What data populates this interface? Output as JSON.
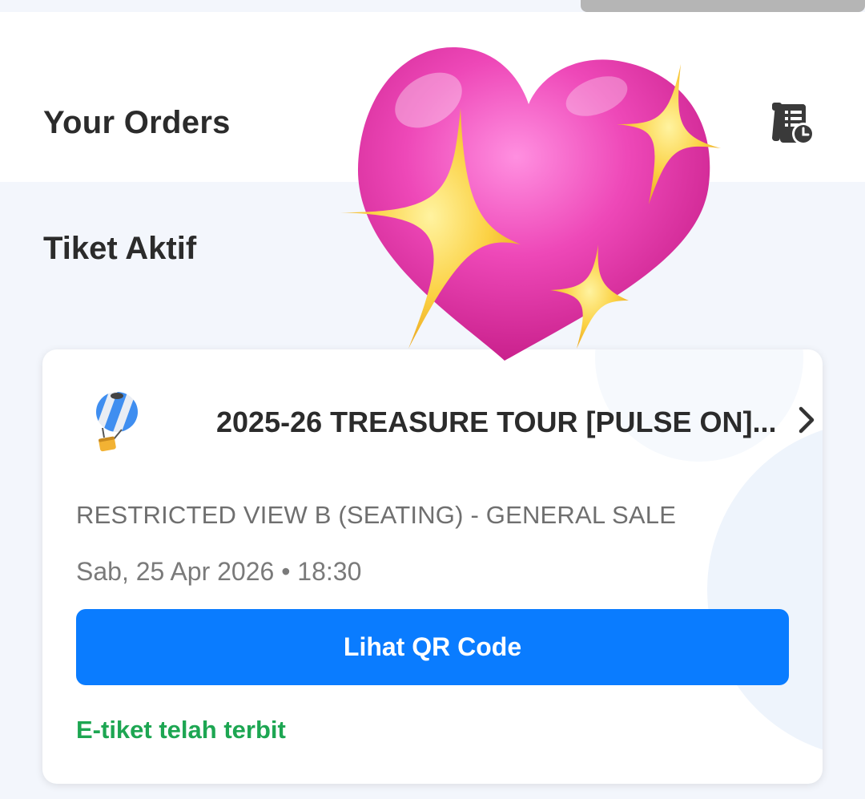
{
  "header": {
    "title": "Your Orders",
    "history_icon": "order-history-icon"
  },
  "section": {
    "title": "Tiket Aktif"
  },
  "ticket": {
    "event_icon": "hot-air-balloon-icon",
    "event_title": "2025-26 TREASURE TOUR [PULSE ON]...",
    "ticket_type": "RESTRICTED VIEW B (SEATING) - GENERAL SALE",
    "date_time": "Sab, 25 Apr 2026 • 18:30",
    "qr_button_label": "Lihat QR Code",
    "status": "E-tiket telah terbit"
  },
  "overlay": {
    "sticker": "sparkling-heart-sticker"
  },
  "colors": {
    "accent": "#0a7cff",
    "status_green": "#1da652",
    "background": "#f3f6fc",
    "heart_pink": "#ec3fa8",
    "sparkle_yellow": "#f8c63a"
  }
}
